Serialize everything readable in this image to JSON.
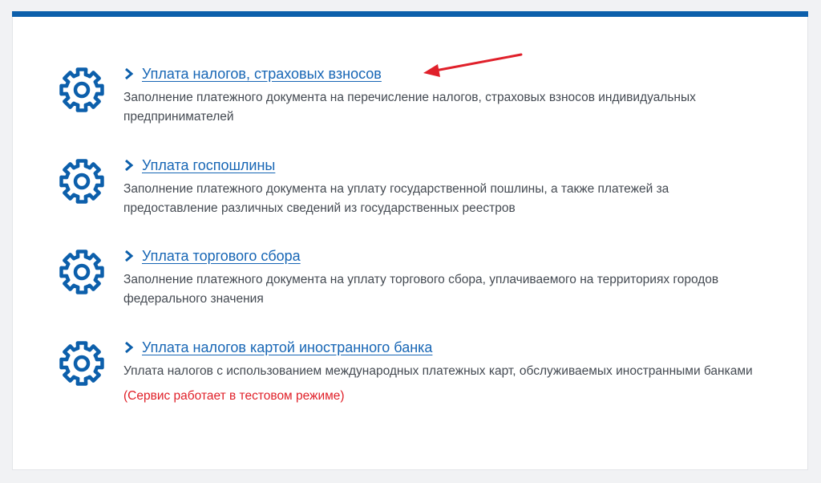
{
  "colors": {
    "accent": "#0c5fab",
    "link": "#1766b5",
    "text": "#444a52",
    "warning": "#e01f28",
    "annotation_arrow": "#e0202a"
  },
  "services": [
    {
      "icon": "gear-icon",
      "title": "Уплата налогов, страховых взносов",
      "description": "Заполнение платежного документа на перечисление налогов, страховых взносов индивидуальных предпринимателей"
    },
    {
      "icon": "gear-icon",
      "title": "Уплата госпошлины",
      "description": "Заполнение платежного документа на уплату государственной пошлины, а также платежей за предоставление различных сведений из государственных реестров"
    },
    {
      "icon": "gear-icon",
      "title": "Уплата торгового сбора",
      "description": "Заполнение платежного документа на уплату торгового сбора, уплачиваемого на территориях городов федерального значения"
    },
    {
      "icon": "gear-icon",
      "title": "Уплата налогов картой иностранного банка",
      "description": "Уплата налогов с использованием международных платежных карт, обслуживаемых иностранными банками",
      "note": "(Сервис работает в тестовом режиме)"
    }
  ]
}
